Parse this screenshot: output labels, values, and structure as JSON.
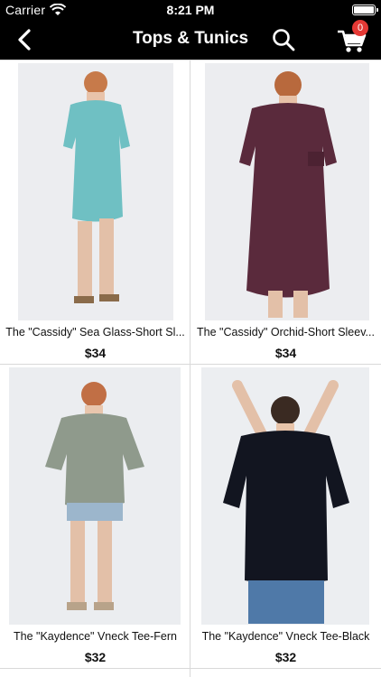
{
  "status_bar": {
    "carrier": "Carrier",
    "time": "8:21 PM"
  },
  "nav": {
    "title": "Tops & Tunics",
    "cart_count": "0"
  },
  "products": [
    {
      "name": "The \"Cassidy\" Sea Glass-Short Sl...",
      "price": "$34",
      "dress_color": "#6fc0c3",
      "bg": "#ecedf0"
    },
    {
      "name": "The \"Cassidy\" Orchid-Short Sleev...",
      "price": "$34",
      "dress_color": "#5a2a3c",
      "bg": "#ecedf0"
    },
    {
      "name": "The \"Kaydence\" Vneck Tee-Fern",
      "price": "$32",
      "dress_color": "#8f9a8c",
      "bg": "#ebedf0"
    },
    {
      "name": "The \"Kaydence\" Vneck Tee-Black",
      "price": "$32",
      "dress_color": "#121520",
      "bg": "#eceef1"
    }
  ]
}
